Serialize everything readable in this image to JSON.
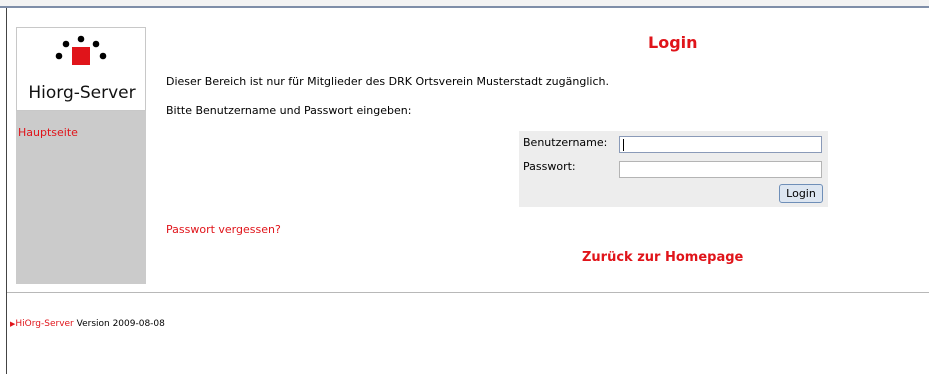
{
  "sidebar": {
    "logo_text": "Hiorg-Server",
    "home_link": "Hauptseite"
  },
  "main": {
    "title": "Login",
    "info_line1": "Dieser Bereich ist nur für Mitglieder des DRK Ortsverein Musterstadt zugänglich.",
    "info_line2": "Bitte Benutzername und Passwort eingeben:",
    "forgot_link": "Passwort vergessen?",
    "back_link": "Zurück zur Homepage"
  },
  "login_form": {
    "username_label": "Benutzername:",
    "username_value": "",
    "password_label": "Passwort:",
    "password_value": "",
    "submit_label": "Login"
  },
  "footer": {
    "arrow": "▶",
    "product_link": "HiOrg-Server",
    "version_text": " Version 2009-08-08"
  },
  "colors": {
    "accent_red": "#e0141a",
    "sidebar_gray": "#cbcbcb",
    "panel_gray": "#ededed"
  }
}
